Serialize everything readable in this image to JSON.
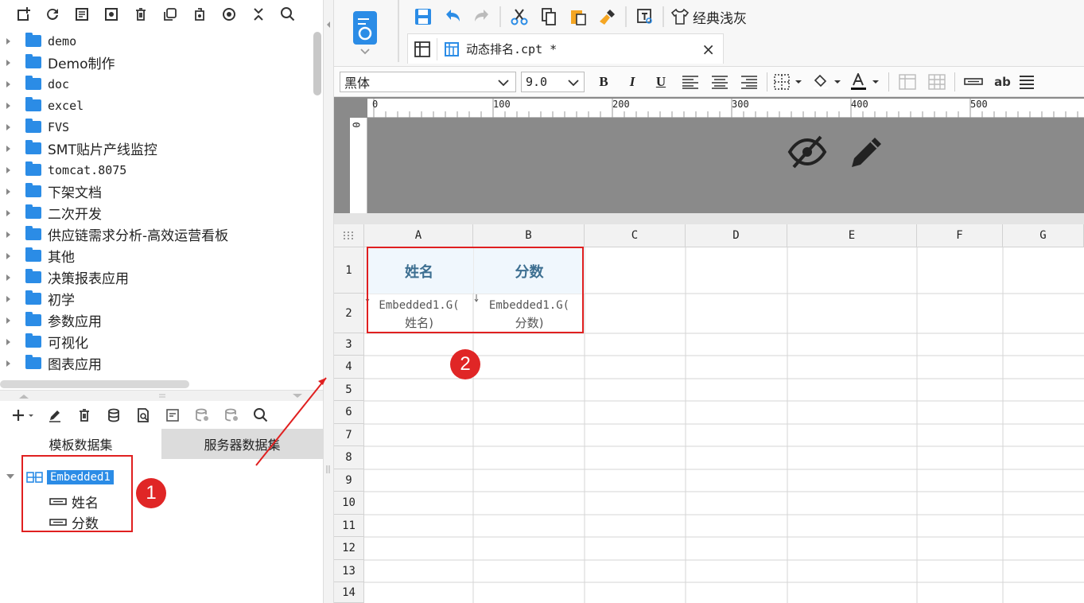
{
  "file_tree": {
    "folders": [
      "demo",
      "Demo制作",
      "doc",
      "excel",
      "FVS",
      "SMT贴片产线监控",
      "tomcat.8075",
      "下架文档",
      "二次开发",
      "供应链需求分析-高效运营看板",
      "其他",
      "决策报表应用",
      "初学",
      "参数应用",
      "可视化",
      "图表应用"
    ]
  },
  "dataset_tabs": [
    "模板数据集",
    "服务器数据集"
  ],
  "dataset": {
    "name": "Embedded1",
    "fields": [
      "姓名",
      "分数"
    ]
  },
  "editor_tab": {
    "title": "动态排名.cpt *",
    "close": "×"
  },
  "toolbar": {
    "theme_label": "经典浅灰"
  },
  "format": {
    "font": "黑体",
    "size": "9.0",
    "bold": "B",
    "italic": "I",
    "underline": "U",
    "ab": "ab"
  },
  "ruler": {
    "ticks": [
      "0",
      "100",
      "200",
      "300",
      "400",
      "500"
    ],
    "vtick": "0"
  },
  "grid": {
    "columns": [
      "A",
      "B",
      "C",
      "D",
      "E",
      "F",
      "G"
    ],
    "rows": [
      "1",
      "2",
      "3",
      "4",
      "5",
      "6",
      "7",
      "8",
      "9",
      "10",
      "11",
      "12",
      "13",
      "14"
    ],
    "cells": {
      "A1": "姓名",
      "B1": "分数",
      "A2_line1": "Embedded1.G(",
      "A2_line2": "姓名)",
      "B2_line1": "Embedded1.G(",
      "B2_line2": "分数)"
    }
  },
  "annotations": {
    "badge1": "1",
    "badge2": "2"
  },
  "colors": {
    "folder": "#2b8ce6",
    "highlight": "#e02020",
    "header_cell": "#f0f7fd",
    "header_text": "#3d6f91"
  }
}
